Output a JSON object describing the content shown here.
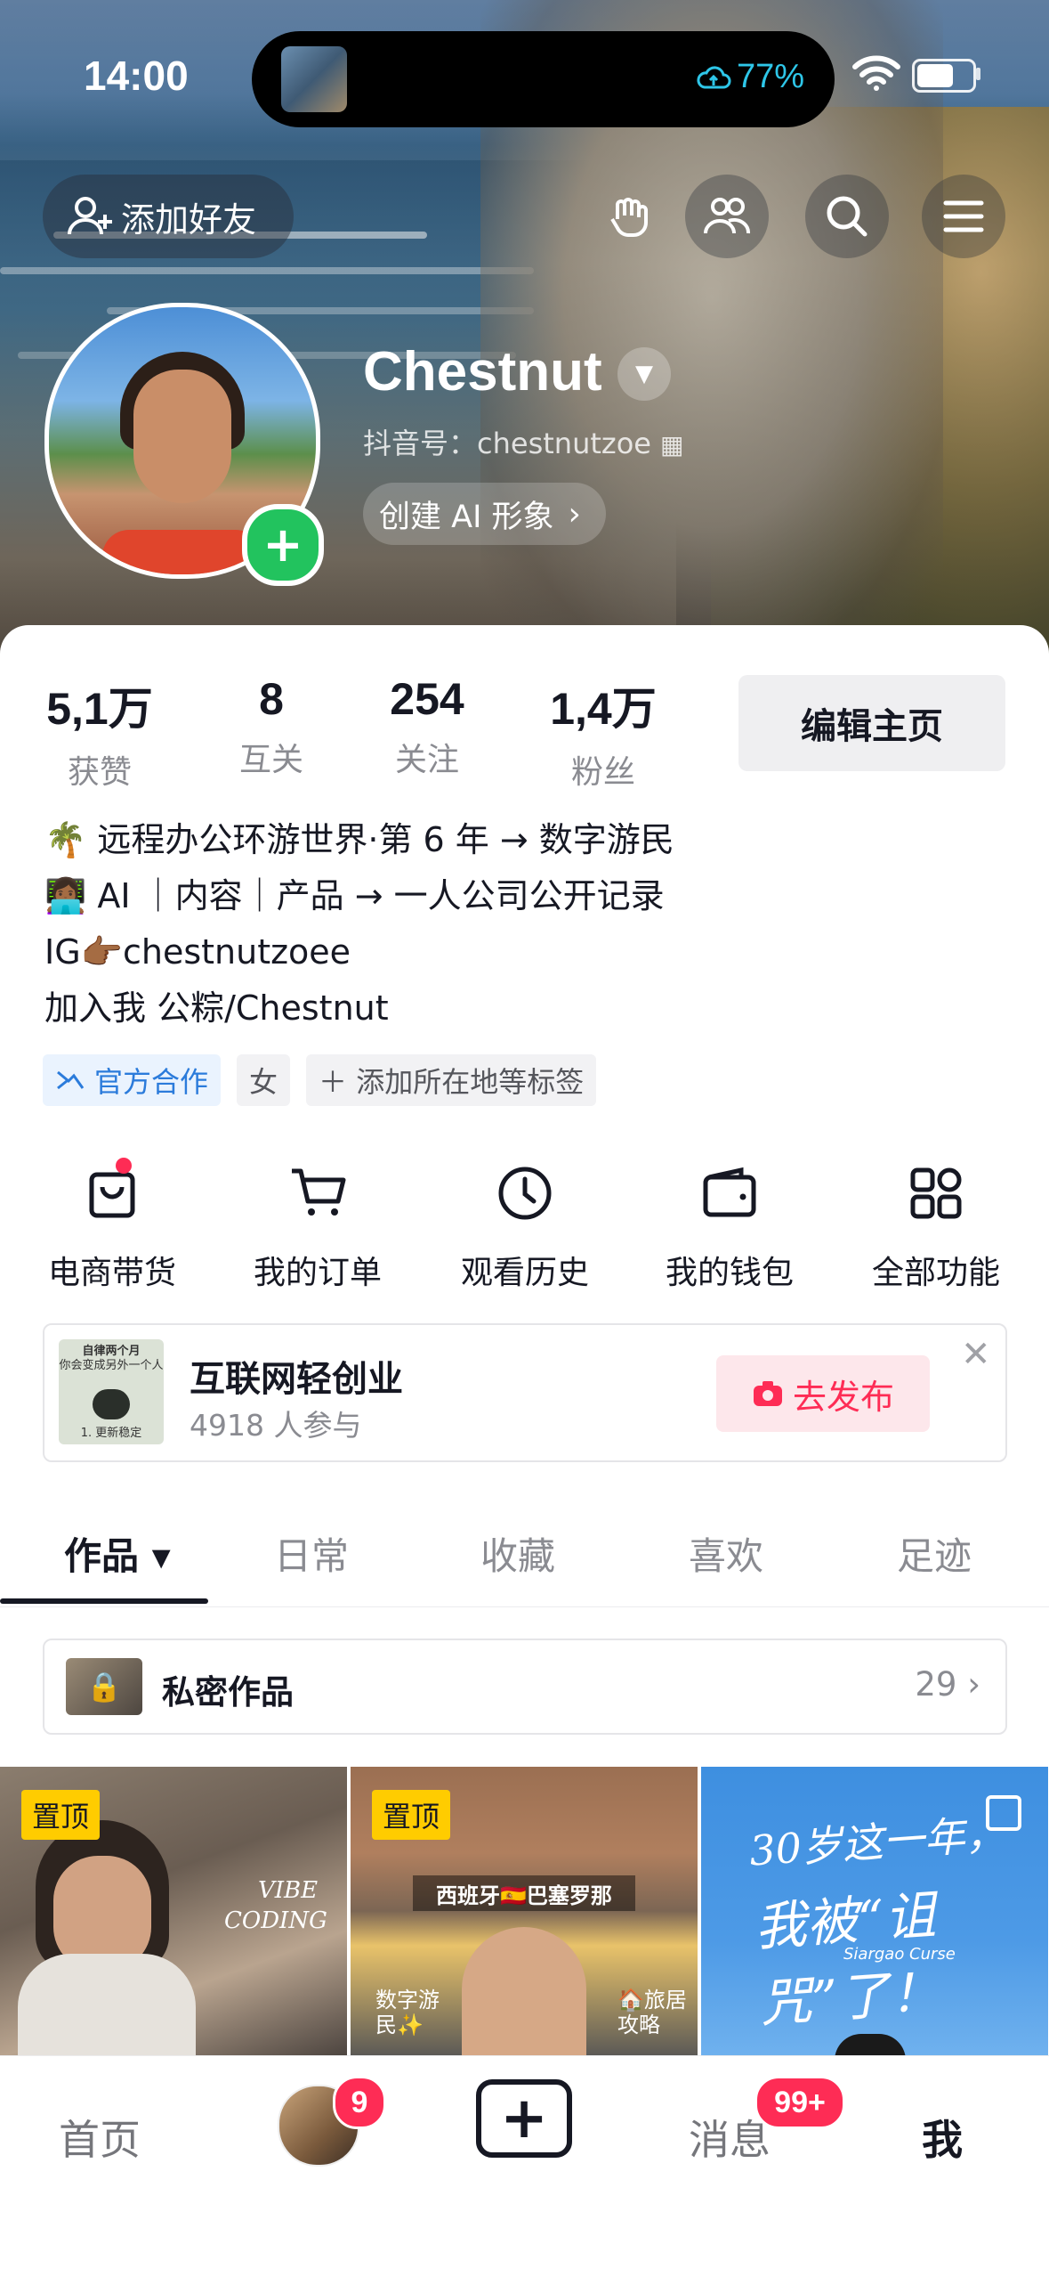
{
  "status_bar": {
    "time": "14:00",
    "battery_text": "77%",
    "icons": [
      "cloud-icon",
      "wifi-icon",
      "battery-icon"
    ]
  },
  "header": {
    "add_friend_label": "添加好友",
    "icons": [
      "add-person-icon",
      "hand-icon",
      "friends-icon",
      "search-icon",
      "menu-icon"
    ]
  },
  "profile": {
    "nickname": "Chestnut",
    "douyin_id": "抖音号：chestnutzoe",
    "ai_button": "创建 AI 形象",
    "ai_chevron": "›",
    "avatar_plus": "+"
  },
  "stats": [
    {
      "value": "5,1万",
      "label": "获赞"
    },
    {
      "value": "8",
      "label": "互关"
    },
    {
      "value": "254",
      "label": "关注"
    },
    {
      "value": "1,4万",
      "label": "粉丝"
    }
  ],
  "edit_button": "编辑主页",
  "bio": {
    "line1": "🌴 远程办公环游世界·第 6 年 → 数字游民",
    "line2": "👩🏾‍💻 AI ｜内容｜产品 → 一人公司公开记录",
    "line3": "IG👉🏾chestnutzoee",
    "line4": "加入我 公粽/Chestnut"
  },
  "tags": {
    "official": "官方合作",
    "gender": "女",
    "add": "＋ 添加所在地等标签"
  },
  "features": [
    {
      "label": "电商带货",
      "icon": "shopping-bag-icon"
    },
    {
      "label": "我的订单",
      "icon": "cart-icon"
    },
    {
      "label": "观看历史",
      "icon": "clock-icon"
    },
    {
      "label": "我的钱包",
      "icon": "wallet-icon"
    },
    {
      "label": "全部功能",
      "icon": "apps-icon"
    }
  ],
  "promo": {
    "thumb_title": "自律两个月",
    "thumb_sub": "你会变成另外一个人",
    "thumb_item": "1. 更新稳定",
    "title": "互联网轻创业",
    "subtitle": "4918 人参与",
    "button": "去发布",
    "close": "✕"
  },
  "tabs": {
    "works": "作品 ▾",
    "daily": "日常",
    "favorites": "收藏",
    "likes": "喜欢",
    "footprints": "足迹"
  },
  "private_works": {
    "label": "私密作品",
    "count": "29 ›"
  },
  "grid": {
    "pin_label": "置顶",
    "cell1_text_a": "VIBE",
    "cell1_text_b": "CODING",
    "cell2_banner": "西班牙🇪🇸巴塞罗那",
    "cell2_left": "数字游民✨",
    "cell2_right": "🏠旅居攻略",
    "cell3_line1": "30岁这一年，",
    "cell3_line2": "我被“诅咒”了！",
    "cell3_small": "Siargao Curse"
  },
  "bottom_nav": {
    "home": "首页",
    "friends_badge": "9",
    "create": "+",
    "messages": "消息",
    "messages_badge": "99+",
    "me": "我"
  }
}
